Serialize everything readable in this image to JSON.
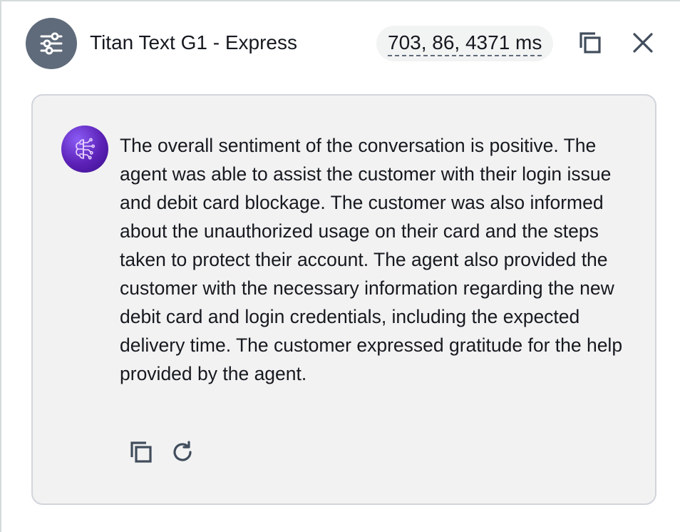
{
  "header": {
    "model_name": "Titan Text G1 - Express",
    "metrics": "703, 86, 4371 ms",
    "settings_icon": "sliders-icon",
    "copy_icon": "copy-icon",
    "close_icon": "close-icon"
  },
  "response": {
    "avatar_icon": "ai-brain-icon",
    "text": "The overall sentiment of the conversation is positive. The agent was able to assist the customer with their login issue and debit card blockage. The customer was also informed about the unauthorized usage on their card and the steps taken to protect their account. The agent also provided the customer with the necessary information regarding the new debit card and login credentials, including the expected delivery time. The customer expressed gratitude for the help provided by the agent.",
    "actions": {
      "copy_icon": "copy-icon",
      "regenerate_icon": "refresh-icon"
    }
  },
  "colors": {
    "settings_bg": "#5f6b7a",
    "card_bg": "#f2f2f2",
    "card_border": "#d1d5db",
    "pill_bg": "#f2f3f3",
    "text": "#16191f",
    "avatar": "#5b21b6"
  }
}
